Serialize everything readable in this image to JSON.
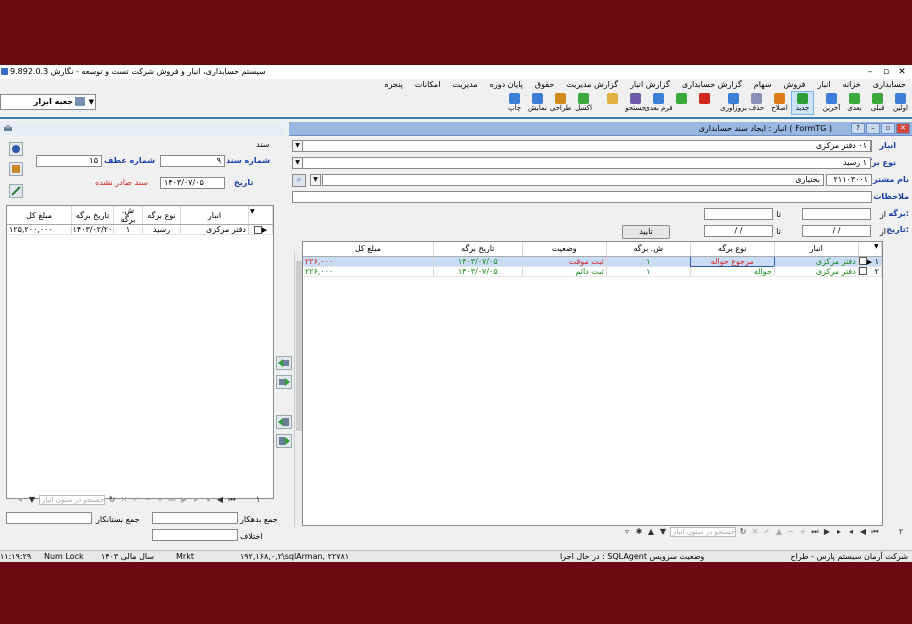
{
  "window": {
    "title": "سیستم حسابداری، انبار و فروش شرکت تست و توسعه - نگارش 9.892.0.3",
    "buttons": [
      "–",
      "▫",
      "✕"
    ]
  },
  "menu": [
    "حسابداری",
    "خزانه",
    "انبار",
    "فروش",
    "سهام",
    "گزارش حسابداری",
    "گزارش انبار",
    "گزارش مدیریت",
    "حقوق",
    "پایان دوره",
    "مدیریت",
    "امکانات",
    "پنجره"
  ],
  "toolbar": [
    {
      "label": "اولین",
      "icon": "first-icon",
      "color": "#3d7fd8"
    },
    {
      "label": "قبلی",
      "icon": "prev-icon",
      "color": "#3aa83a"
    },
    {
      "label": "بعدی",
      "icon": "next-icon",
      "color": "#3aa83a"
    },
    {
      "label": "آخرین",
      "icon": "last-icon",
      "color": "#3d7fd8"
    },
    {
      "label": "جدید",
      "icon": "new-icon",
      "color": "#2f9e3a"
    },
    {
      "label": "اصلاح",
      "icon": "edit-icon",
      "color": "#e07b1a"
    },
    {
      "label": "حذف",
      "icon": "delete-icon",
      "color": "#8a8fb8"
    },
    {
      "label": "بروزآوری",
      "icon": "refresh-icon",
      "color": "#3d7fd8"
    },
    {
      "label": "",
      "icon": "cancel-icon",
      "color": "#d0271f"
    },
    {
      "label": "",
      "icon": "confirm-icon",
      "color": "#3aa83a"
    },
    {
      "label": "فرم بعدی",
      "icon": "next-form-icon",
      "color": "#3d7fd8"
    },
    {
      "label": "جستجو",
      "icon": "search-icon",
      "color": "#6b5ba8"
    },
    {
      "label": "",
      "icon": "filter-icon",
      "color": "#e0b040"
    },
    {
      "label": "اکسل",
      "icon": "excel-icon",
      "color": "#3aa83a"
    },
    {
      "label": "طراحی",
      "icon": "design-icon",
      "color": "#d08a1a"
    },
    {
      "label": "نمایش",
      "icon": "preview-icon",
      "color": "#3d7fd8"
    },
    {
      "label": "چاپ",
      "icon": "print-icon",
      "color": "#3d7fd8"
    }
  ],
  "tray": {
    "label": "جعبه ابزار"
  },
  "form_window": {
    "title": "انبار : ایجاد سند حسابداری ( FormTG )"
  },
  "filters": {
    "warehouse_label": "انبار",
    "warehouse_value": "۰۱  دفتر مرکزی",
    "slip_type_label": "نوع برگه",
    "slip_type_value": "۱  رسید",
    "customer_label": "نام مشتری",
    "customer_code": "۲۱۱۰۳۰۰۱",
    "customer_name": "بختیاری",
    "notes_label": "ملاحظات",
    "slip_label": "برگه:",
    "from_label": "از",
    "to_label": "تا",
    "date_label": "تاریخ:",
    "date_from": "/  /",
    "date_to": "/  /",
    "confirm_button": "تایید"
  },
  "main_grid": {
    "columns": [
      "انبار",
      "نوع برگه",
      "ش. برگه",
      "وضعیت",
      "تاریخ برگه",
      "مبلغ کل"
    ],
    "rows": [
      {
        "num": "۱",
        "warehouse": "دفتر مرکزی",
        "type": "مرجوع حواله",
        "slip": "۱",
        "status": "ثبت موقت",
        "date": "۱۴۰۳/۰۷/۰۵",
        "amount": "۲۲۶,۰۰۰"
      },
      {
        "num": "۲",
        "warehouse": "دفتر مرکزی",
        "type": "حواله",
        "slip": "۱",
        "status": "ثبت دائم",
        "date": "۱۴۰۳/۰۷/۰۵",
        "amount": "۲۲۶,۰۰۰"
      }
    ],
    "footer_count": "۲",
    "search_placeholder": "جستجو در ستون انبار"
  },
  "voucher": {
    "section_label": "سند",
    "doc_no_label": "شماره سند",
    "doc_no": "۹",
    "ref_no_label": "شماره عطف",
    "ref_no": "۱۵",
    "date_label": "تاریخ",
    "date": "۱۴۰۳/۰۷/۰۵",
    "status": "سند صادر نشده"
  },
  "left_grid": {
    "columns": [
      "انبار",
      "نوع برگه",
      "ش. برگه",
      "تاریخ برگه",
      "مبلغ کل"
    ],
    "rows": [
      {
        "warehouse": "دفتر مرکزی",
        "type": "رسید",
        "slip": "۱",
        "date": "۱۴۰۳/۰۲/۲۰",
        "amount": "۱۲۵,۲۰۰,۰۰۰"
      }
    ],
    "footer_count": "۱",
    "search_placeholder": "جستجو در ستون انبار"
  },
  "totals": {
    "debit_label": "جمع بدهکار",
    "credit_label": "جمع بستانکار",
    "diff_label": "اختلاف"
  },
  "statusbar": {
    "company": "شرکت آرمان سیستم پارس - طراح",
    "service": "در حال اجرا : SQLAgent وضعیت سرویس",
    "server": "۱۹۲,۱۶۸,۰,۲\\sqlArman, ۲۲۷۸۱",
    "db": "Mrkt",
    "fiscal_year": "سال مالی ۱۴۰۳",
    "numlock": "Num Lock",
    "time": "۱۱:۱۹:۲۹"
  }
}
